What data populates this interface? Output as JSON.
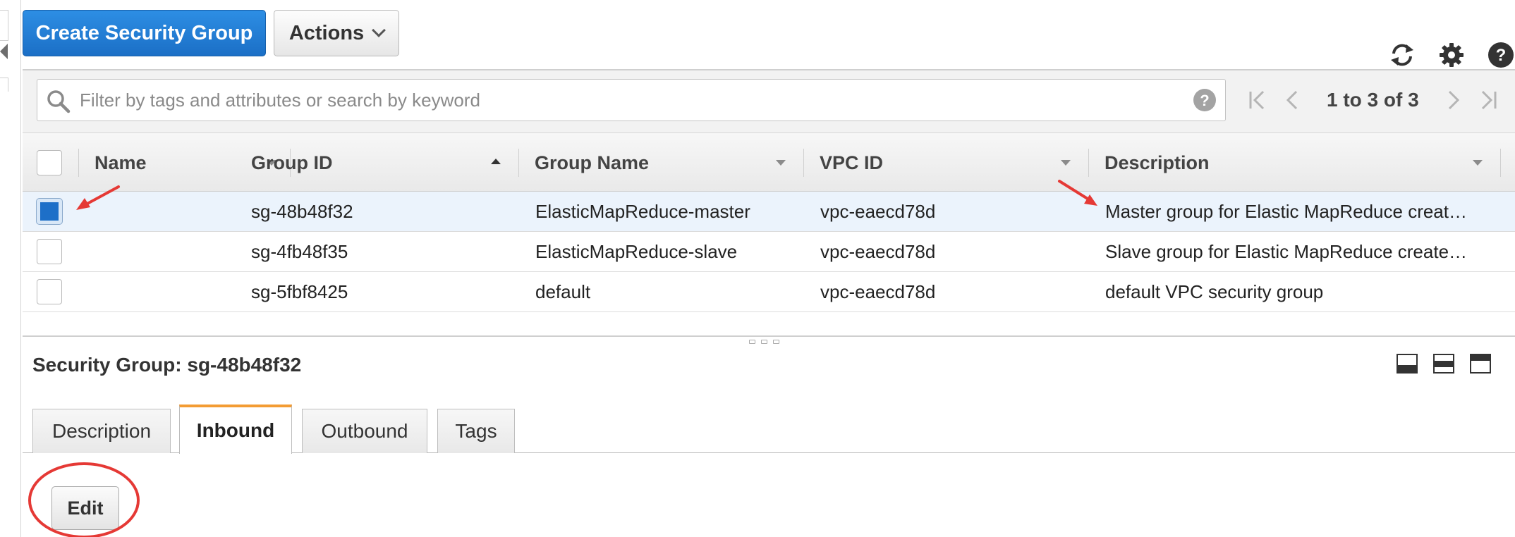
{
  "toolbar": {
    "create_label": "Create Security Group",
    "actions_label": "Actions"
  },
  "search": {
    "placeholder": "Filter by tags and attributes or search by keyword"
  },
  "pagination": {
    "label": "1 to 3 of 3"
  },
  "table": {
    "columns": [
      "Name",
      "Group ID",
      "Group Name",
      "VPC ID",
      "Description"
    ],
    "rows": [
      {
        "name": "",
        "group_id": "sg-48b48f32",
        "group_name": "ElasticMapReduce-master",
        "vpc_id": "vpc-eaecd78d",
        "description": "Master group for Elastic MapReduce creat…",
        "selected": true
      },
      {
        "name": "",
        "group_id": "sg-4fb48f35",
        "group_name": "ElasticMapReduce-slave",
        "vpc_id": "vpc-eaecd78d",
        "description": "Slave group for Elastic MapReduce create…",
        "selected": false
      },
      {
        "name": "",
        "group_id": "sg-5fbf8425",
        "group_name": "default",
        "vpc_id": "vpc-eaecd78d",
        "description": "default VPC security group",
        "selected": false
      }
    ]
  },
  "detail": {
    "title": "Security Group: sg-48b48f32",
    "tabs": [
      "Description",
      "Inbound",
      "Outbound",
      "Tags"
    ],
    "active_tab": "Inbound",
    "edit_label": "Edit"
  },
  "colors": {
    "primary": "#1b6fc8",
    "tab_accent": "#f39c33",
    "annotation": "#e53935"
  },
  "icons": [
    "refresh-icon",
    "gear-icon",
    "help-icon",
    "search-icon",
    "first-page-icon",
    "prev-page-icon",
    "next-page-icon",
    "last-page-icon"
  ]
}
